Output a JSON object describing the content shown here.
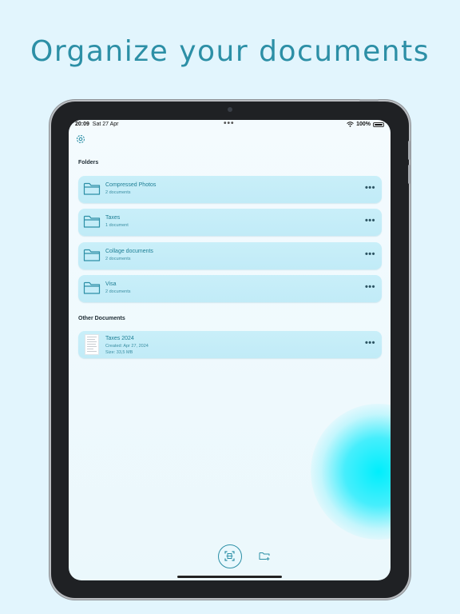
{
  "headline": "Organize your documents",
  "status_bar": {
    "time": "20:09",
    "date": "Sat 27 Apr",
    "battery": "100%"
  },
  "sections": {
    "folders_label": "Folders",
    "other_label": "Other Documents"
  },
  "folders": [
    {
      "name": "Compressed Photos",
      "count": "2 documents"
    },
    {
      "name": "Taxes",
      "count": "1 document"
    },
    {
      "name": "Collage documents",
      "count": "2 documents"
    },
    {
      "name": "Visa",
      "count": "2 documents"
    }
  ],
  "documents": [
    {
      "name": "Taxes 2024",
      "created": "Created: Apr 27, 2024",
      "size": "Size: 33,5 MB"
    }
  ],
  "icons": {
    "settings": "gear-icon",
    "folder": "folder-icon",
    "more": "more-dots-icon",
    "scan": "scan-document-icon",
    "new_folder": "new-folder-icon"
  },
  "colors": {
    "accent": "#2c8fa6",
    "row_bg": "#c5edf8",
    "page_bg": "#e2f5fd"
  }
}
